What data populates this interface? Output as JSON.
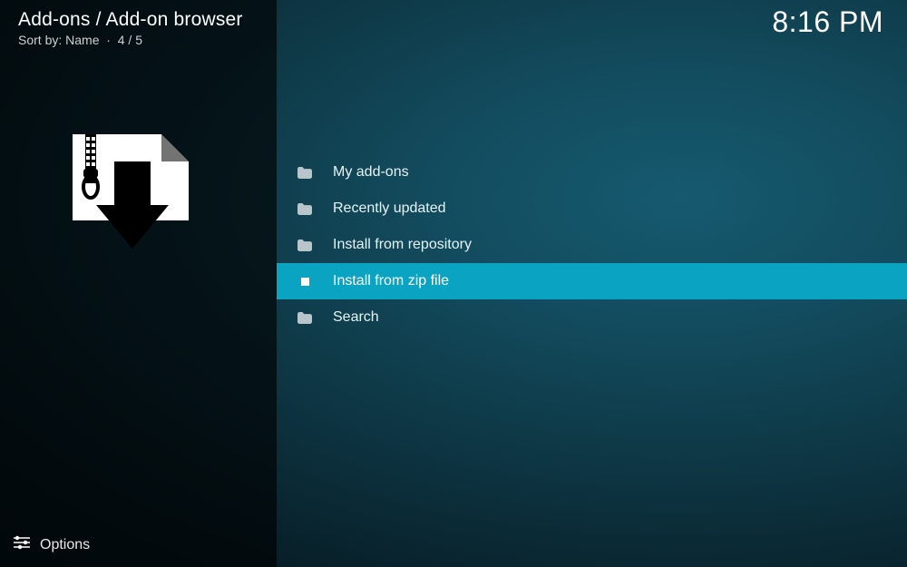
{
  "header": {
    "breadcrumb": "Add-ons / Add-on browser",
    "sort_label": "Sort by:",
    "sort_value": "Name",
    "position": "4 / 5"
  },
  "clock": "8:16 PM",
  "menu": {
    "items": [
      {
        "label": "My add-ons",
        "icon": "folder",
        "selected": false
      },
      {
        "label": "Recently updated",
        "icon": "folder",
        "selected": false
      },
      {
        "label": "Install from repository",
        "icon": "folder",
        "selected": false
      },
      {
        "label": "Install from zip file",
        "icon": "zip",
        "selected": true
      },
      {
        "label": "Search",
        "icon": "folder",
        "selected": false
      }
    ]
  },
  "footer": {
    "options_label": "Options"
  },
  "icons": {
    "folder": "folder-icon",
    "zip": "zip-file-icon",
    "options": "sliders-icon",
    "sidebar_art": "zip-download-icon"
  }
}
